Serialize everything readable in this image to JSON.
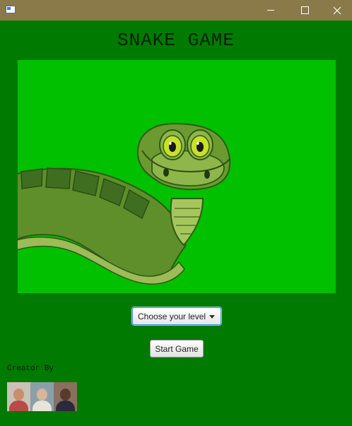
{
  "window": {
    "minimize_icon": "minimize-icon",
    "maximize_icon": "maximize-icon",
    "close_icon": "close-icon"
  },
  "title": "SNAKE GAME",
  "game_area": {
    "background": "#00c000",
    "image": "cartoon-snake"
  },
  "level_select": {
    "value": "Choose your level"
  },
  "start_button": {
    "label": "Start Game"
  },
  "creator": {
    "label": "Creator By",
    "avatars": [
      "creator-1",
      "creator-2",
      "creator-3"
    ]
  },
  "colors": {
    "window_background": "#007a00",
    "titlebar": "#8a7a4a",
    "game_area": "#00c000"
  }
}
